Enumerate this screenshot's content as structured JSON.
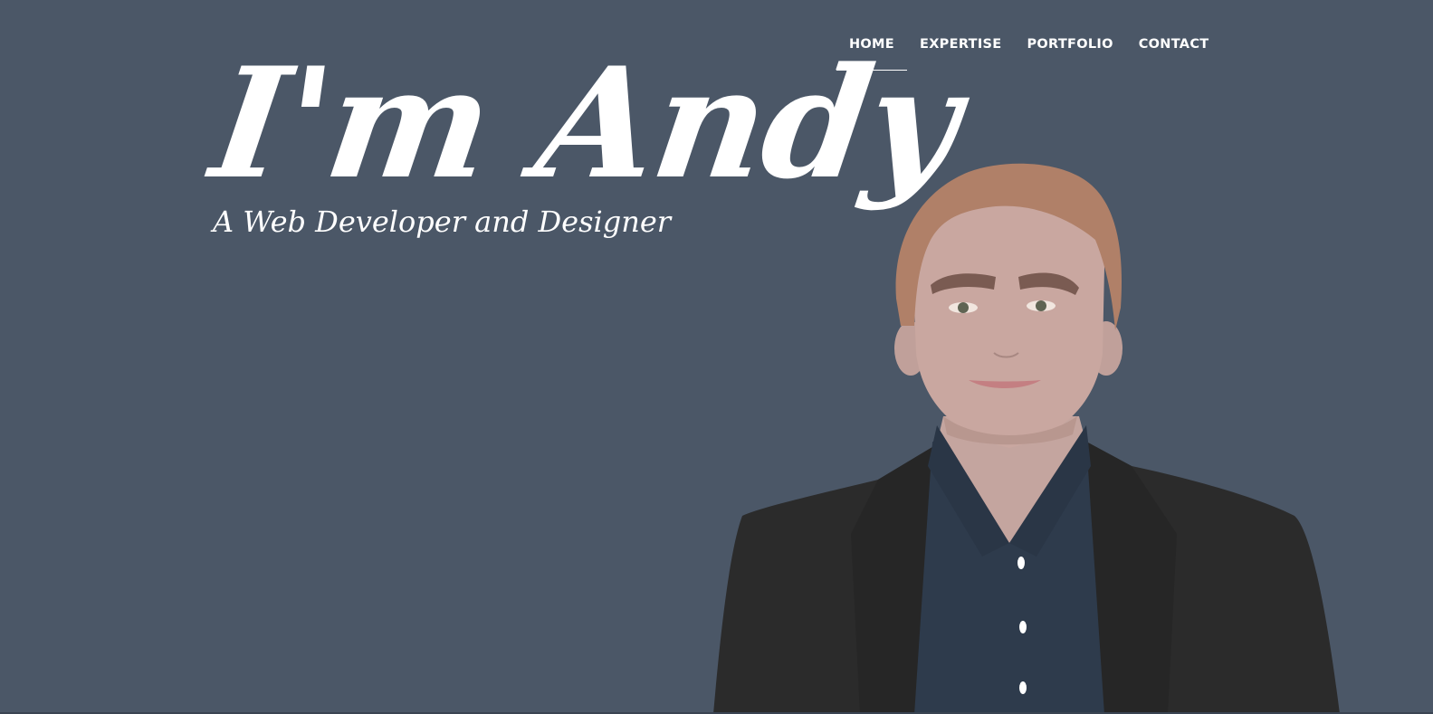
{
  "nav": {
    "items": [
      {
        "label": "HOME",
        "active": true
      },
      {
        "label": "EXPERTISE",
        "active": false
      },
      {
        "label": "PORTFOLIO",
        "active": false
      },
      {
        "label": "CONTACT",
        "active": false
      }
    ]
  },
  "hero": {
    "title": "I'm Andy",
    "subtitle": "A Web Developer and Designer"
  },
  "colors": {
    "background": "#4b5767",
    "text": "#ffffff",
    "hair": "#b08068",
    "skin": "#c9a7a0",
    "jacket": "#2b2b2b",
    "shirt": "#2e3b4c"
  },
  "illustration": {
    "icon": "person-portrait-illustration"
  }
}
